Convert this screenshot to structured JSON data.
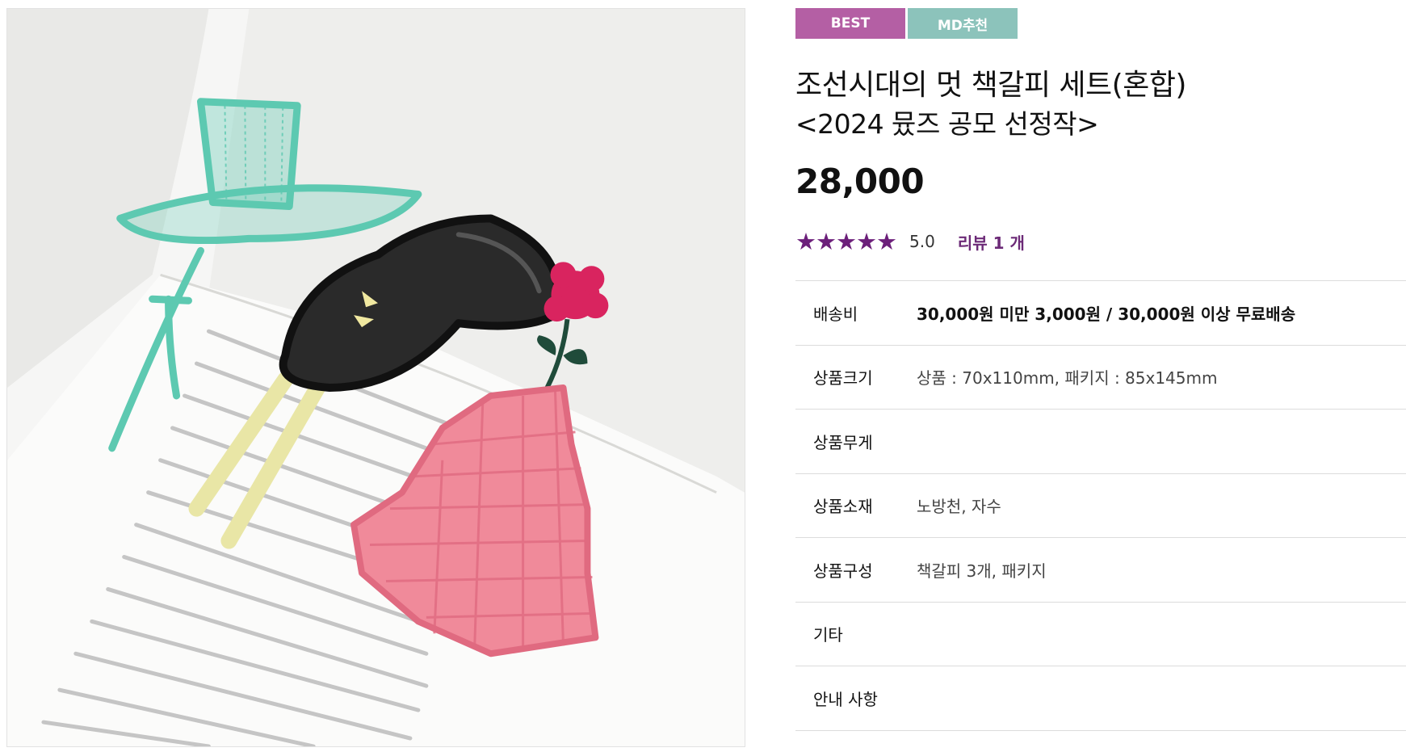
{
  "badges": {
    "best": "BEST",
    "md": "MD추천"
  },
  "product": {
    "title": "조선시대의 멋 책갈피 세트(혼합)",
    "subtitle": "<2024 뮸즈 공모 선정작>",
    "price": "28,000"
  },
  "rating": {
    "stars": "★★★★★",
    "score": "5.0",
    "reviews_label": "리뷰 1 개",
    "star_color": "#6c1f7a"
  },
  "specs": [
    {
      "label": "배송비",
      "value": "30,000원 미만 3,000원 / 30,000원 이상 무료배송"
    },
    {
      "label": "상품크기",
      "value": "상품 : 70x110mm, 패키지 : 85x145mm"
    },
    {
      "label": "상품무게",
      "value": ""
    },
    {
      "label": "상품소재",
      "value": "노방천, 자수"
    },
    {
      "label": "상품구성",
      "value": "책갈피 3개, 패키지"
    },
    {
      "label": "기타",
      "value": ""
    },
    {
      "label": "안내 사항",
      "value": ""
    }
  ],
  "colors": {
    "best_badge": "#b45fa4",
    "md_badge": "#8cc3bb",
    "accent": "#6c2a77"
  }
}
